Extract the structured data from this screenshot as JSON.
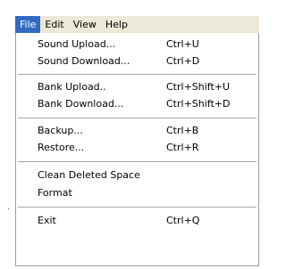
{
  "menubar": {
    "items": [
      {
        "label": "File",
        "active": true
      },
      {
        "label": "Edit",
        "active": false
      },
      {
        "label": "View",
        "active": false
      },
      {
        "label": "Help",
        "active": false
      }
    ]
  },
  "file_menu": {
    "items": [
      {
        "label": "Sound Upload...",
        "shortcut": "Ctrl+U"
      },
      {
        "label": "Sound Download...",
        "shortcut": "Ctrl+D"
      },
      {
        "label": "Bank Upload..",
        "shortcut": "Ctrl+Shift+U"
      },
      {
        "label": "Bank Download...",
        "shortcut": "Ctrl+Shift+D"
      },
      {
        "label": "Backup...",
        "shortcut": "Ctrl+B"
      },
      {
        "label": "Restore...",
        "shortcut": "Ctrl+R"
      },
      {
        "label": "Clean Deleted Space",
        "shortcut": ""
      },
      {
        "label": "Format",
        "shortcut": ""
      },
      {
        "label": "Exit",
        "shortcut": "Ctrl+Q"
      }
    ]
  },
  "colors": {
    "menubar_bg": "#ece9d8",
    "highlight_bg": "#316ac5",
    "highlight_fg": "#ffffff",
    "separator": "#a6a6a6"
  }
}
